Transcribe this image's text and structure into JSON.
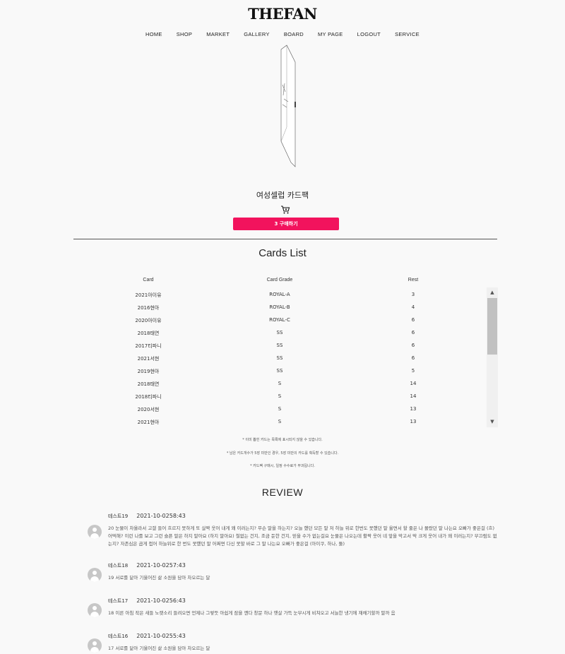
{
  "brand": {
    "logo": "THEFAN"
  },
  "nav": [
    "HOME",
    "SHOP",
    "MARKET",
    "GALLERY",
    "BOARD",
    "MY PAGE",
    "LOGOUT",
    "SERVICE"
  ],
  "product": {
    "name": "여성셀럽 카드팩",
    "buy_label": "3 구매하기"
  },
  "cards": {
    "title": "Cards List",
    "headers": [
      "Card",
      "Card Grade",
      "Rest"
    ],
    "rows": [
      [
        "2021아이유",
        "ROYAL-A",
        "3"
      ],
      [
        "2016현아",
        "ROYAL-B",
        "4"
      ],
      [
        "2020아이유",
        "ROYAL-C",
        "6"
      ],
      [
        "2018태연",
        "SS",
        "6"
      ],
      [
        "2017티파니",
        "SS",
        "6"
      ],
      [
        "2021서현",
        "SS",
        "6"
      ],
      [
        "2019현아",
        "SS",
        "5"
      ],
      [
        "2018태연",
        "S",
        "14"
      ],
      [
        "2018티파니",
        "S",
        "14"
      ],
      [
        "2020서현",
        "S",
        "13"
      ],
      [
        "2021현아",
        "S",
        "13"
      ]
    ],
    "notes": [
      "* 이미 뽑힌 카드는 목록에 표시되지 않을 수 있습니다.",
      "* 남은 카드개수가 5장 미만인 경우, 5장 미만의 카드를 획득할 수 있습니다.",
      "* 카드팩 구매시, 일정 수수료가 부과됩니다."
    ]
  },
  "reviews": {
    "title": "REVIEW",
    "items": [
      {
        "user": "테스트19",
        "date": "2021-10-0258:43",
        "text": "20 눈물이 차올라서 고갤 들어 흐르지 못하게 또 살짝 웃어 내게 왜 이러는지? 무슨 말을 하는지? 오늘 했던 모든 말 저 하늘 위로 한번도 못했던 말 울면서 할 줄은 나 몰랐던 말 나는요 오빠가 좋은걸 (흐) 어떡해? 이런 나를 보고 그런 슬픈 말은 하지 말아요 (하지 말아요) 철없는 건지, 조금 둔한 건지, 믿을 수가 없는걸요 눈물은 나오는데 활짝 웃어 네 앞을 막고서 딱 크게 웃어 내가 왜 이러는지? 부끄럼도 없는지? 자존심은 곱게 접어 하늘위로 한 번도 못했던 말 어쩌면 다신 못할 바로 그 말 나는요 오빠가 좋은걸 (아이쿠, 하나, 둘)"
      },
      {
        "user": "테스트18",
        "date": "2021-10-0257:43",
        "text": "19 서로를 닮아 기울어진 삶 소원을 담아 차오르는 달"
      },
      {
        "user": "테스트17",
        "date": "2021-10-0256:43",
        "text": "18 이른 아침 작은 새들 노랫소리 들려오면 언제나 그렇듯 아쉽게 잠을 깬다 창문 하나 햇살 가득 눈부시게 비쳐오고 서늘한 냉기에 재채기할까 말까 음"
      },
      {
        "user": "테스트16",
        "date": "2021-10-0255:43",
        "text": "17 서로를 닮아 기울어진 삶 소원을 담아 차오르는 달"
      }
    ]
  }
}
